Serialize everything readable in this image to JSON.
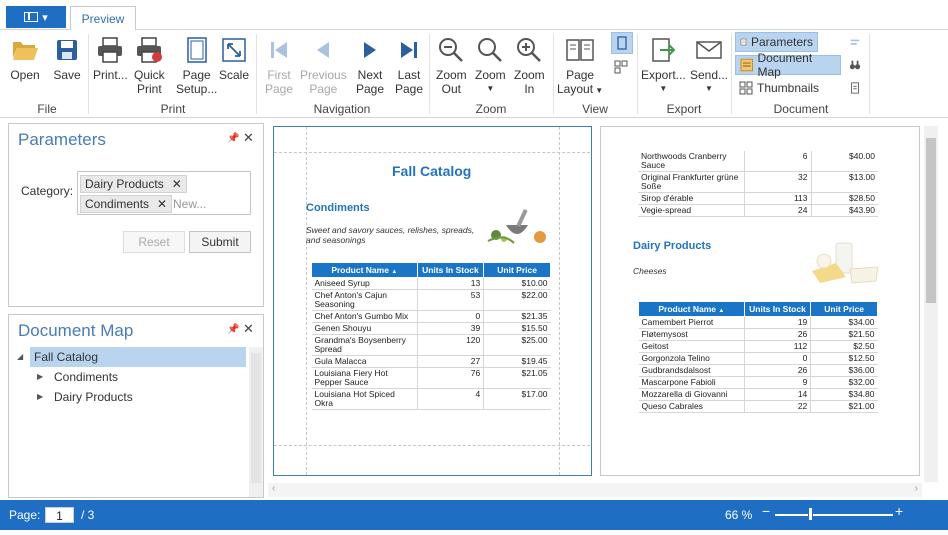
{
  "tabs": {
    "app_menu": "app-menu",
    "preview": "Preview"
  },
  "ribbon": {
    "file": {
      "label": "File",
      "open": "Open",
      "save": "Save"
    },
    "print": {
      "label": "Print",
      "print": "Print...",
      "quick_print_1": "Quick",
      "quick_print_2": "Print",
      "page_setup_1": "Page",
      "page_setup_2": "Setup...",
      "scale": "Scale"
    },
    "navigation": {
      "label": "Navigation",
      "first_1": "First",
      "first_2": "Page",
      "prev_1": "Previous",
      "prev_2": "Page",
      "next_1": "Next",
      "next_2": "Page",
      "last_1": "Last",
      "last_2": "Page"
    },
    "zoom": {
      "label": "Zoom",
      "zoom_out_1": "Zoom",
      "zoom_out_2": "Out",
      "zoom": "Zoom",
      "zoom_in_1": "Zoom",
      "zoom_in_2": "In"
    },
    "view": {
      "label": "View",
      "page_layout_1": "Page",
      "page_layout_2": "Layout"
    },
    "export": {
      "label": "Export",
      "export": "Export...",
      "send": "Send..."
    },
    "document": {
      "label": "Document",
      "parameters": "Parameters",
      "document_map": "Document Map",
      "thumbnails": "Thumbnails"
    }
  },
  "parameters_panel": {
    "title": "Parameters",
    "category_label": "Category:",
    "tokens": [
      "Dairy Products",
      "Condiments"
    ],
    "new_placeholder": "New...",
    "reset": "Reset",
    "submit": "Submit"
  },
  "document_map": {
    "title": "Document Map",
    "root": "Fall Catalog",
    "children": [
      "Condiments",
      "Dairy Products"
    ]
  },
  "page1": {
    "title": "Fall Catalog",
    "category": "Condiments",
    "description": "Sweet and savory sauces, relishes, spreads, and seasonings",
    "headers": [
      "Product Name",
      "Units In Stock",
      "Unit Price"
    ],
    "rows": [
      [
        "Aniseed Syrup",
        "13",
        "$10.00"
      ],
      [
        "Chef Anton's Cajun Seasoning",
        "53",
        "$22.00"
      ],
      [
        "Chef Anton's Gumbo Mix",
        "0",
        "$21.35"
      ],
      [
        "Genen Shouyu",
        "39",
        "$15.50"
      ],
      [
        "Grandma's Boysenberry Spread",
        "120",
        "$25.00"
      ],
      [
        "Gula Malacca",
        "27",
        "$19.45"
      ],
      [
        "Louisiana Fiery Hot Pepper Sauce",
        "76",
        "$21.05"
      ],
      [
        "Louisiana Hot Spiced Okra",
        "4",
        "$17.00"
      ]
    ]
  },
  "page2": {
    "continued_rows": [
      [
        "Northwoods Cranberry Sauce",
        "6",
        "$40.00"
      ],
      [
        "Original Frankfurter grüne Soße",
        "32",
        "$13.00"
      ],
      [
        "Sirop d'érable",
        "113",
        "$28.50"
      ],
      [
        "Vegie-spread",
        "24",
        "$43.90"
      ]
    ],
    "category": "Dairy Products",
    "description": "Cheeses",
    "headers": [
      "Product Name",
      "Units In Stock",
      "Unit Price"
    ],
    "rows": [
      [
        "Camembert Pierrot",
        "19",
        "$34.00"
      ],
      [
        "Fløtemysost",
        "26",
        "$21.50"
      ],
      [
        "Geitost",
        "112",
        "$2.50"
      ],
      [
        "Gorgonzola Telino",
        "0",
        "$12.50"
      ],
      [
        "Gudbrandsdalsost",
        "26",
        "$36.00"
      ],
      [
        "Mascarpone Fabioli",
        "9",
        "$32.00"
      ],
      [
        "Mozzarella di Giovanni",
        "14",
        "$34.80"
      ],
      [
        "Queso Cabrales",
        "22",
        "$21.00"
      ]
    ]
  },
  "status": {
    "page_label": "Page:",
    "page_value": "1",
    "page_total": "/ 3",
    "zoom": "66 %"
  },
  "colors": {
    "accent": "#1e6fc4",
    "header_blue": "#1b75c6",
    "selection": "#b9d4ef"
  }
}
